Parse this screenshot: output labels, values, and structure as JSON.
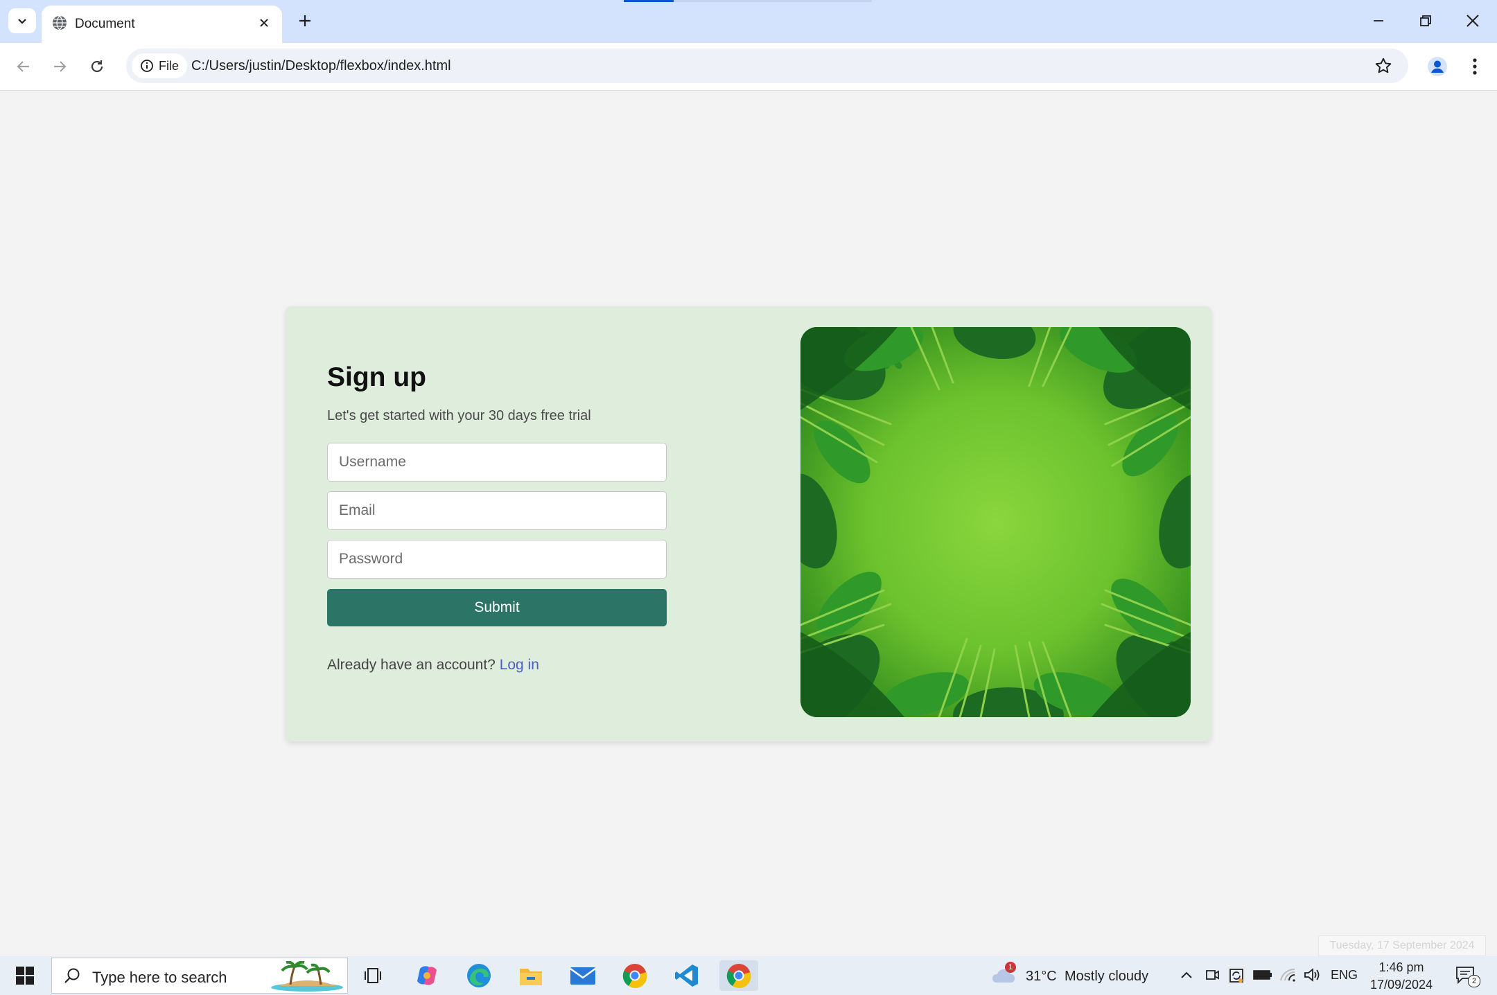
{
  "browser": {
    "tab_title": "Document",
    "address_scheme_chip": "File",
    "url": "C:/Users/justin/Desktop/flexbox/index.html"
  },
  "page": {
    "heading": "Sign up",
    "subtitle": "Let's get started with your 30 days free trial",
    "username_placeholder": "Username",
    "email_placeholder": "Email",
    "password_placeholder": "Password",
    "submit_label": "Submit",
    "already_text": "Already have an account?",
    "login_link": "Log in",
    "colors": {
      "card_bg": "#dfeddd",
      "submit_bg": "#2c7466",
      "link": "#4a5fc1"
    }
  },
  "taskbar": {
    "search_placeholder": "Type here to search",
    "weather_badge": "1",
    "weather_temp": "31°C",
    "weather_desc": "Mostly cloudy",
    "language": "ENG",
    "time": "1:46 pm",
    "date": "17/09/2024",
    "notification_count": "2",
    "date_tooltip": "Tuesday, 17 September 2024"
  }
}
